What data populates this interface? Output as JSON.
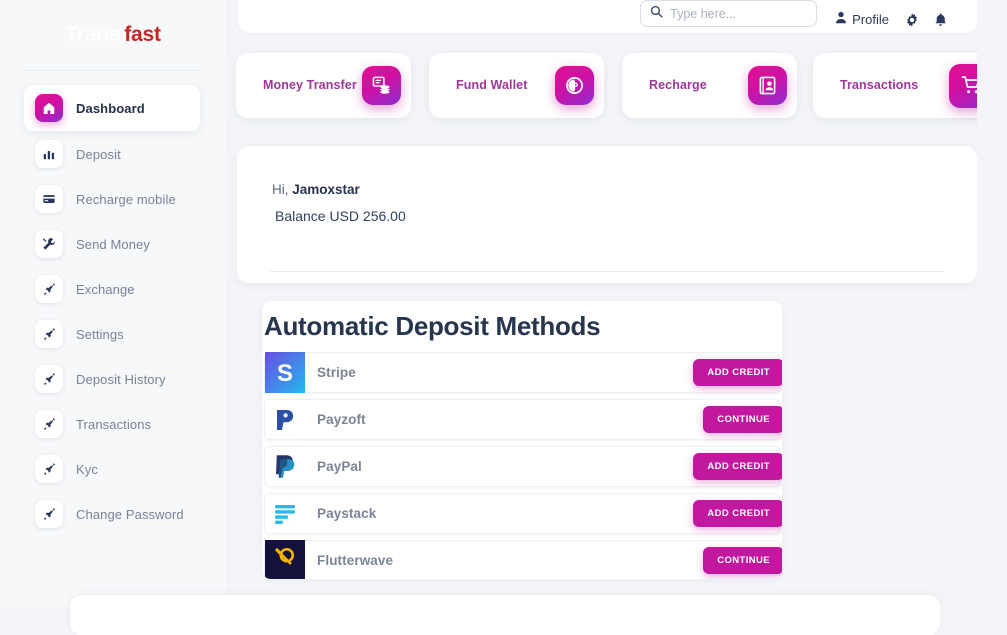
{
  "brand": {
    "part1": "Trans",
    "part2": "fast"
  },
  "sidebar": {
    "items": [
      {
        "label": "Dashboard",
        "icon": "dashboard-icon",
        "active": true
      },
      {
        "label": "Deposit",
        "icon": "bar-chart-icon",
        "active": false
      },
      {
        "label": "Recharge mobile",
        "icon": "credit-card-icon",
        "active": false
      },
      {
        "label": "Send Money",
        "icon": "tools-icon",
        "active": false
      },
      {
        "label": "Exchange",
        "icon": "rocket-icon",
        "active": false
      },
      {
        "label": "Settings",
        "icon": "rocket-icon",
        "active": false
      },
      {
        "label": "Deposit History",
        "icon": "rocket-icon",
        "active": false
      },
      {
        "label": "Transactions",
        "icon": "rocket-icon",
        "active": false
      },
      {
        "label": "Kyc",
        "icon": "rocket-icon",
        "active": false
      },
      {
        "label": "Change Password",
        "icon": "rocket-icon",
        "active": false
      }
    ]
  },
  "header": {
    "search": {
      "value": "",
      "placeholder": "Type here...",
      "icon": "search-icon"
    },
    "profile_label": "Profile",
    "profile_icon": "user-icon",
    "settings_icon": "gear-icon",
    "notifications_icon": "bell-icon"
  },
  "shortcut_cards": [
    {
      "label": "Money Transfer",
      "icon": "transfer-icon"
    },
    {
      "label": "Fund Wallet",
      "icon": "coin-icon"
    },
    {
      "label": "Recharge",
      "icon": "contact-card-icon"
    },
    {
      "label": "Transactions",
      "icon": "cart-icon"
    }
  ],
  "balance": {
    "greeting_prefix": "Hi, ",
    "user_name": "Jamoxstar",
    "balance_text": "Balance USD 256.00"
  },
  "deposit": {
    "title": "Automatic Deposit Methods",
    "methods": [
      {
        "name": "Stripe",
        "logo": "stripe-logo",
        "action": "ADD CREDIT"
      },
      {
        "name": "Payzoft",
        "logo": "payzoft-logo",
        "action": "CONTINUE"
      },
      {
        "name": "PayPal",
        "logo": "paypal-logo",
        "action": "ADD CREDIT"
      },
      {
        "name": "Paystack",
        "logo": "paystack-logo",
        "action": "ADD CREDIT"
      },
      {
        "name": "Flutterwave",
        "logo": "flutterwave-logo",
        "action": "CONTINUE"
      }
    ]
  },
  "colors": {
    "accent_magenta": "#c2179f",
    "accent_gradient_start": "#e30f8f",
    "accent_gradient_end": "#8e2ed0",
    "brand_red": "#cc2222",
    "page_background": "#f3f5f8",
    "card_label": "#a0359b"
  }
}
